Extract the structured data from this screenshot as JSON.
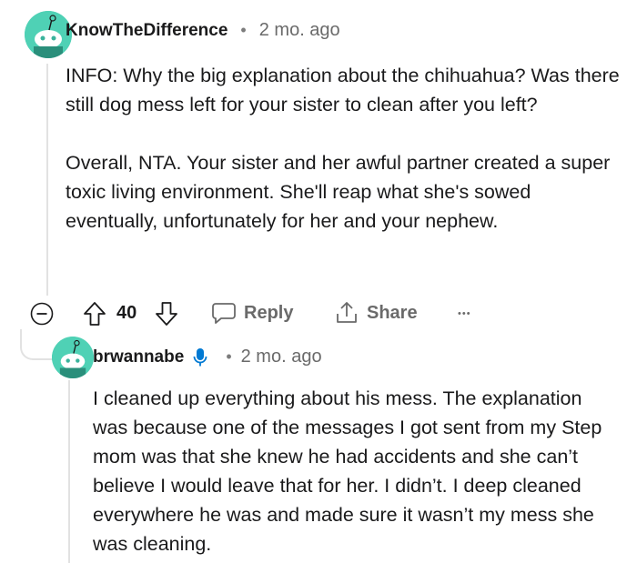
{
  "comment": {
    "username": "KnowTheDifference",
    "separator": "•",
    "timestamp": "2 mo. ago",
    "paragraphs": [
      "INFO: Why the big explanation about the chihuahua? Was there still dog mess left for your sister to clean after you left?",
      "Overall, NTA. Your sister and her awful partner created a super toxic living environment. She'll reap what she's sowed eventually, unfortunately for her and your nephew."
    ],
    "votes": "40",
    "reply_label": "Reply",
    "share_label": "Share",
    "more_label": "•••"
  },
  "reply": {
    "username": "brwannabe",
    "separator": "•",
    "timestamp": "2 mo. ago",
    "body": "I cleaned up everything about his mess. The explanation was because one of the messages I got sent from my Step mom was that she knew he had accidents and she can’t believe I would leave that for her. I didn’t. I deep cleaned everywhere he was and made sure it wasn’t my mess she was cleaning."
  },
  "colors": {
    "avatar": "#4fd1b5",
    "text": "#1a1a1b",
    "meta": "#6a6a6a"
  }
}
